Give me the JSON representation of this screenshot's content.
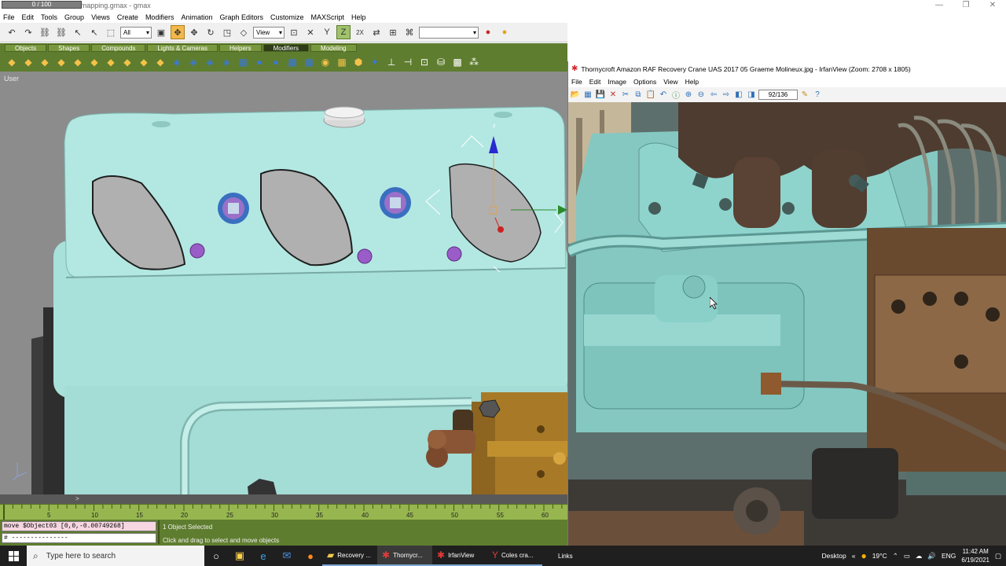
{
  "gmax": {
    "title": "Coles crane 983 new mapping.gmax - gmax",
    "menu": [
      "File",
      "Edit",
      "Tools",
      "Group",
      "Views",
      "Create",
      "Modifiers",
      "Animation",
      "Graph Editors",
      "Customize",
      "MAXScript",
      "Help"
    ],
    "toolbar": {
      "selection_filter": "All",
      "ref_coord": "View",
      "named_sel": ""
    },
    "tabs": [
      "Objects",
      "Shapes",
      "Compounds",
      "Lights & Cameras",
      "Helpers",
      "Modifiers",
      "Modeling"
    ],
    "selected_tab": "Modifiers",
    "viewport_label": "User",
    "gizmo_axis": "z",
    "time_slider": "0 / 100",
    "ruler_ticks": [
      "5",
      "10",
      "15",
      "20",
      "25",
      "30",
      "35",
      "40",
      "45",
      "50",
      "55",
      "60"
    ],
    "script_input": "move $Object03 [0,0,-0.00749268]",
    "script_output": "# ---------------",
    "status_selection": "1 Object Selected",
    "status_prompt": "Click and drag to select and move objects"
  },
  "irfanview": {
    "title": "Thornycroft Amazon RAF Recovery Crane UAS 2017 05 Graeme Molineux.jpg - IrfanView (Zoom: 2708 x 1805)",
    "menu": [
      "File",
      "Edit",
      "Image",
      "Options",
      "View",
      "Help"
    ],
    "page_counter": "92/136"
  },
  "taskbar": {
    "search_placeholder": "Type here to search",
    "apps": [
      {
        "label": "Recovery ...",
        "icon": "folder-icon"
      },
      {
        "label": "Thornycr...",
        "icon": "irfanview-icon"
      },
      {
        "label": "IrfanView",
        "icon": "irfanview-icon"
      },
      {
        "label": "Coles cra...",
        "icon": "gmax-icon"
      }
    ],
    "links": "Links",
    "desktop": "Desktop",
    "weather": "19°C",
    "lang": "ENG",
    "time": "11:42 AM",
    "date": "6/19/2021"
  },
  "colors": {
    "accent": "#5f7d2f",
    "engine": "#a8e0da",
    "active_tool": "#f2b84b"
  }
}
